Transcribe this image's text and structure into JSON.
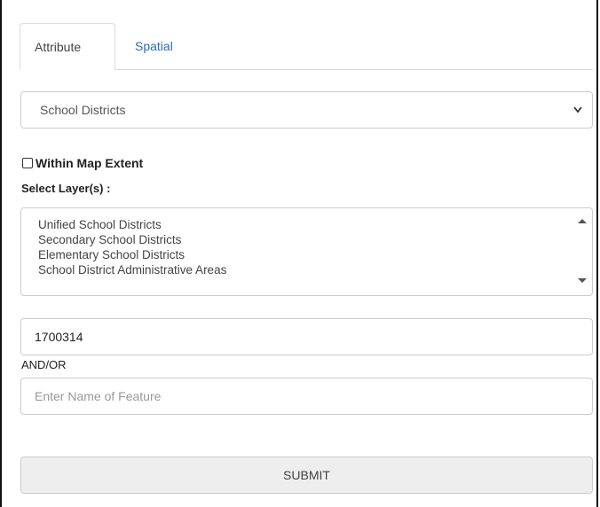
{
  "tabs": {
    "attribute_label": "Attribute",
    "spatial_label": "Spatial"
  },
  "layer_select": {
    "selected": "School Districts"
  },
  "within_map_extent": {
    "label": "Within Map Extent",
    "checked": false
  },
  "select_layers": {
    "label": "Select Layer(s) :",
    "items": [
      "Unified School Districts",
      "Secondary School Districts",
      "Elementary School Districts",
      "School District Administrative Areas"
    ]
  },
  "id_input": {
    "value": "1700314"
  },
  "andor_label": "AND/OR",
  "name_input": {
    "value": "",
    "placeholder": "Enter Name of Feature"
  },
  "submit_label": "SUBMIT",
  "colors": {
    "tab_link": "#2a6fb0",
    "border": "#cccccc",
    "submit_bg": "#eeeeee"
  }
}
